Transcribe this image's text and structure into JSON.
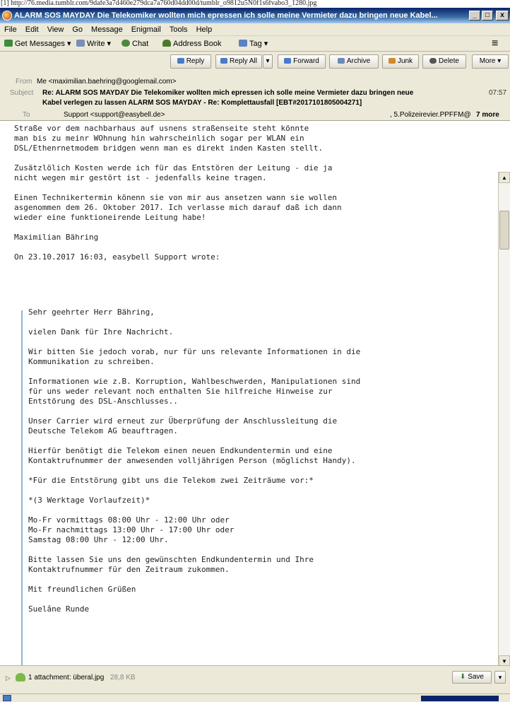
{
  "url_strip": "[1] http://76.media.tumblr.com/9dafe3a7d460e279dca7a760d04dd00d/tumblr_o9812u5N0f1s6fvabo3_1280.jpg",
  "window": {
    "title": "ALARM SOS MAYDAY Die Telekomiker wollten mich epressen ich solle meine Vermieter dazu bringen neue Kabel...",
    "min": "_",
    "max": "□",
    "close": "x"
  },
  "menu": [
    "File",
    "Edit",
    "View",
    "Go",
    "Message",
    "Enigmail",
    "Tools",
    "Help"
  ],
  "toolbar": {
    "get_messages": "Get Messages",
    "write": "Write",
    "chat": "Chat",
    "address_book": "Address Book",
    "tag": "Tag"
  },
  "header": {
    "buttons": {
      "reply": "Reply",
      "reply_all": "Reply All",
      "forward": "Forward",
      "archive": "Archive",
      "junk": "Junk",
      "delete": "Delete",
      "more": "More"
    },
    "from_label": "From",
    "from_value": "Me <maximilian.baehring@googlemail.com>",
    "subject_label": "Subject",
    "subject_line1": "Re: ALARM SOS MAYDAY Die Telekomiker wollten mich epressen ich solle meine Vermieter dazu bringen neue",
    "subject_line2": "Kabel verlegen zu lassen ALARM SOS MAYDAY - Re: Komplettausfall [EBT#2017101805004271]",
    "time": "07:57",
    "to_label": "To",
    "to_value": "Support <support@easybell.de>",
    "to_more_cc": ", 5.Polizeirevier.PPFFM@",
    "to_more": "7 more"
  },
  "body_top": [
    "Straße vor dem nachbarhaus auf usnens straßenseite steht könnte",
    "man bis zu meinr WOhnung hin wahrscheinlich sogar per WLAN ein",
    "DSL/Ethenrnetmodem bridgen wenn man es direkt inden Kasten stellt.",
    "",
    "Zusätzlölich Kosten werde ich für das Entstören der Leitung - die ja",
    "nicht wegen mir gestört ist - jedenfalls keine tragen.",
    "",
    "Einen Technikertermin könenn sie von mir aus ansetzen wann sie wollen",
    "asgenommen dem 26. Oktober 2017. Ich verlasse mich darauf daß ich dann",
    "wieder eine funktioneirende Leitung habe!",
    "",
    "Maximilian Bähring",
    "",
    "On 23.10.2017 16:03, easybell Support wrote:"
  ],
  "quoted": [
    "Sehr geehrter Herr Bähring,",
    "",
    "vielen Dank für Ihre Nachricht.",
    "",
    "Wir bitten Sie jedoch vorab, nur für uns relevante Informationen in die",
    "Kommunikation zu schreiben.",
    "",
    "Informationen wie z.B. Korruption, Wahlbeschwerden, Manipulationen sind",
    "für uns weder relevant noch enthalten Sie hilfreiche Hinweise zur",
    "Entstörung des DSL-Anschlusses..",
    "",
    "Unser Carrier wird erneut zur Überprüfung der Anschlussleitung die",
    "Deutsche Telekom AG beauftragen.",
    "",
    "Hierfür benötigt die Telekom einen neuen Endkundentermin und eine",
    "Kontaktrufnummer der anwesenden volljährigen Person (möglichst Handy).",
    "",
    "*Für die Entstörung gibt uns die Telekom zwei Zeiträume vor:*",
    "",
    "*(3 Werktage Vorlaufzeit)*",
    "",
    "Mo-Fr vormittags 08:00 Uhr - 12:00 Uhr oder",
    "Mo-Fr nachmittags 13:00 Uhr - 17:00 Uhr oder",
    "Samstag 08:00 Uhr - 12:00 Uhr.",
    "",
    "Bitte lassen Sie uns den gewünschten Endkundentermin und Ihre",
    "Kontaktrufnummer für den Zeitraum zukommen.",
    "",
    "Mit freundlichen Grüßen",
    "",
    "Suelâne Runde"
  ],
  "attachment": {
    "summary": "1 attachment: überal.jpg",
    "size": "28,8 KB",
    "save": "Save"
  }
}
